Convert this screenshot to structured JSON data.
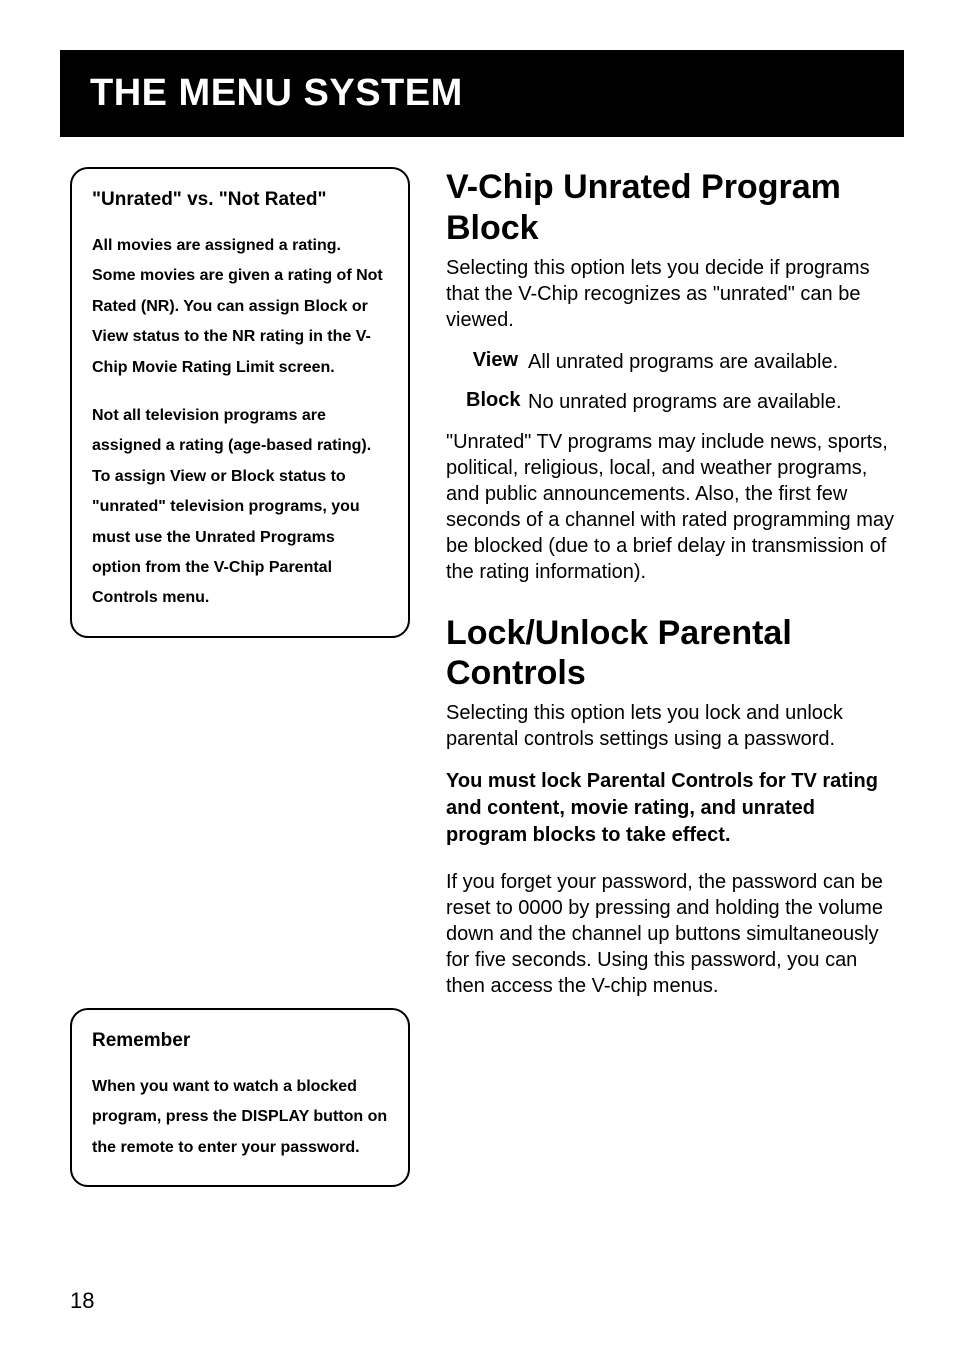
{
  "header": {
    "title": "THE MENU SYSTEM"
  },
  "leftColumn": {
    "callout1": {
      "title": "\"Unrated\" vs. \"Not Rated\"",
      "p1": "All movies are assigned a rating. Some movies are given a rating of Not Rated (NR). You can assign Block or View status to the NR rating in the V-Chip Movie Rating Limit screen.",
      "p2": "Not all television programs are assigned a rating (age-based rating). To assign View or Block status to \"unrated\" television programs, you must use the Unrated Programs option from the V-Chip Parental Controls menu."
    },
    "callout2": {
      "title": "Remember",
      "p1": "When you want to watch a blocked program, press the DISPLAY button on the remote to enter your password."
    }
  },
  "rightColumn": {
    "section1": {
      "heading": "V-Chip Unrated Program Block",
      "intro": "Selecting this option lets you decide if programs that the V-Chip recognizes as \"unrated\" can be viewed.",
      "defs": [
        {
          "term": "View",
          "desc": "All unrated programs are available."
        },
        {
          "term": "Block",
          "desc": "No unrated programs are available."
        }
      ],
      "body": "\"Unrated\" TV programs may include news, sports, political, religious, local, and weather programs, and public announcements.  Also, the first few seconds of a channel with rated programming may be blocked  (due to a brief delay in transmission of the rating information)."
    },
    "section2": {
      "heading": "Lock/Unlock Parental Controls",
      "intro": "Selecting this option lets you lock and unlock parental controls settings using a password.",
      "strong": "You must lock Parental Controls for TV rating and content, movie rating, and unrated program blocks to take effect.",
      "body": "If you forget your password, the password can be reset to 0000 by pressing and holding the volume down and the channel up buttons simultaneously for five seconds. Using this password, you can then access the V-chip menus."
    }
  },
  "pageNumber": "18"
}
